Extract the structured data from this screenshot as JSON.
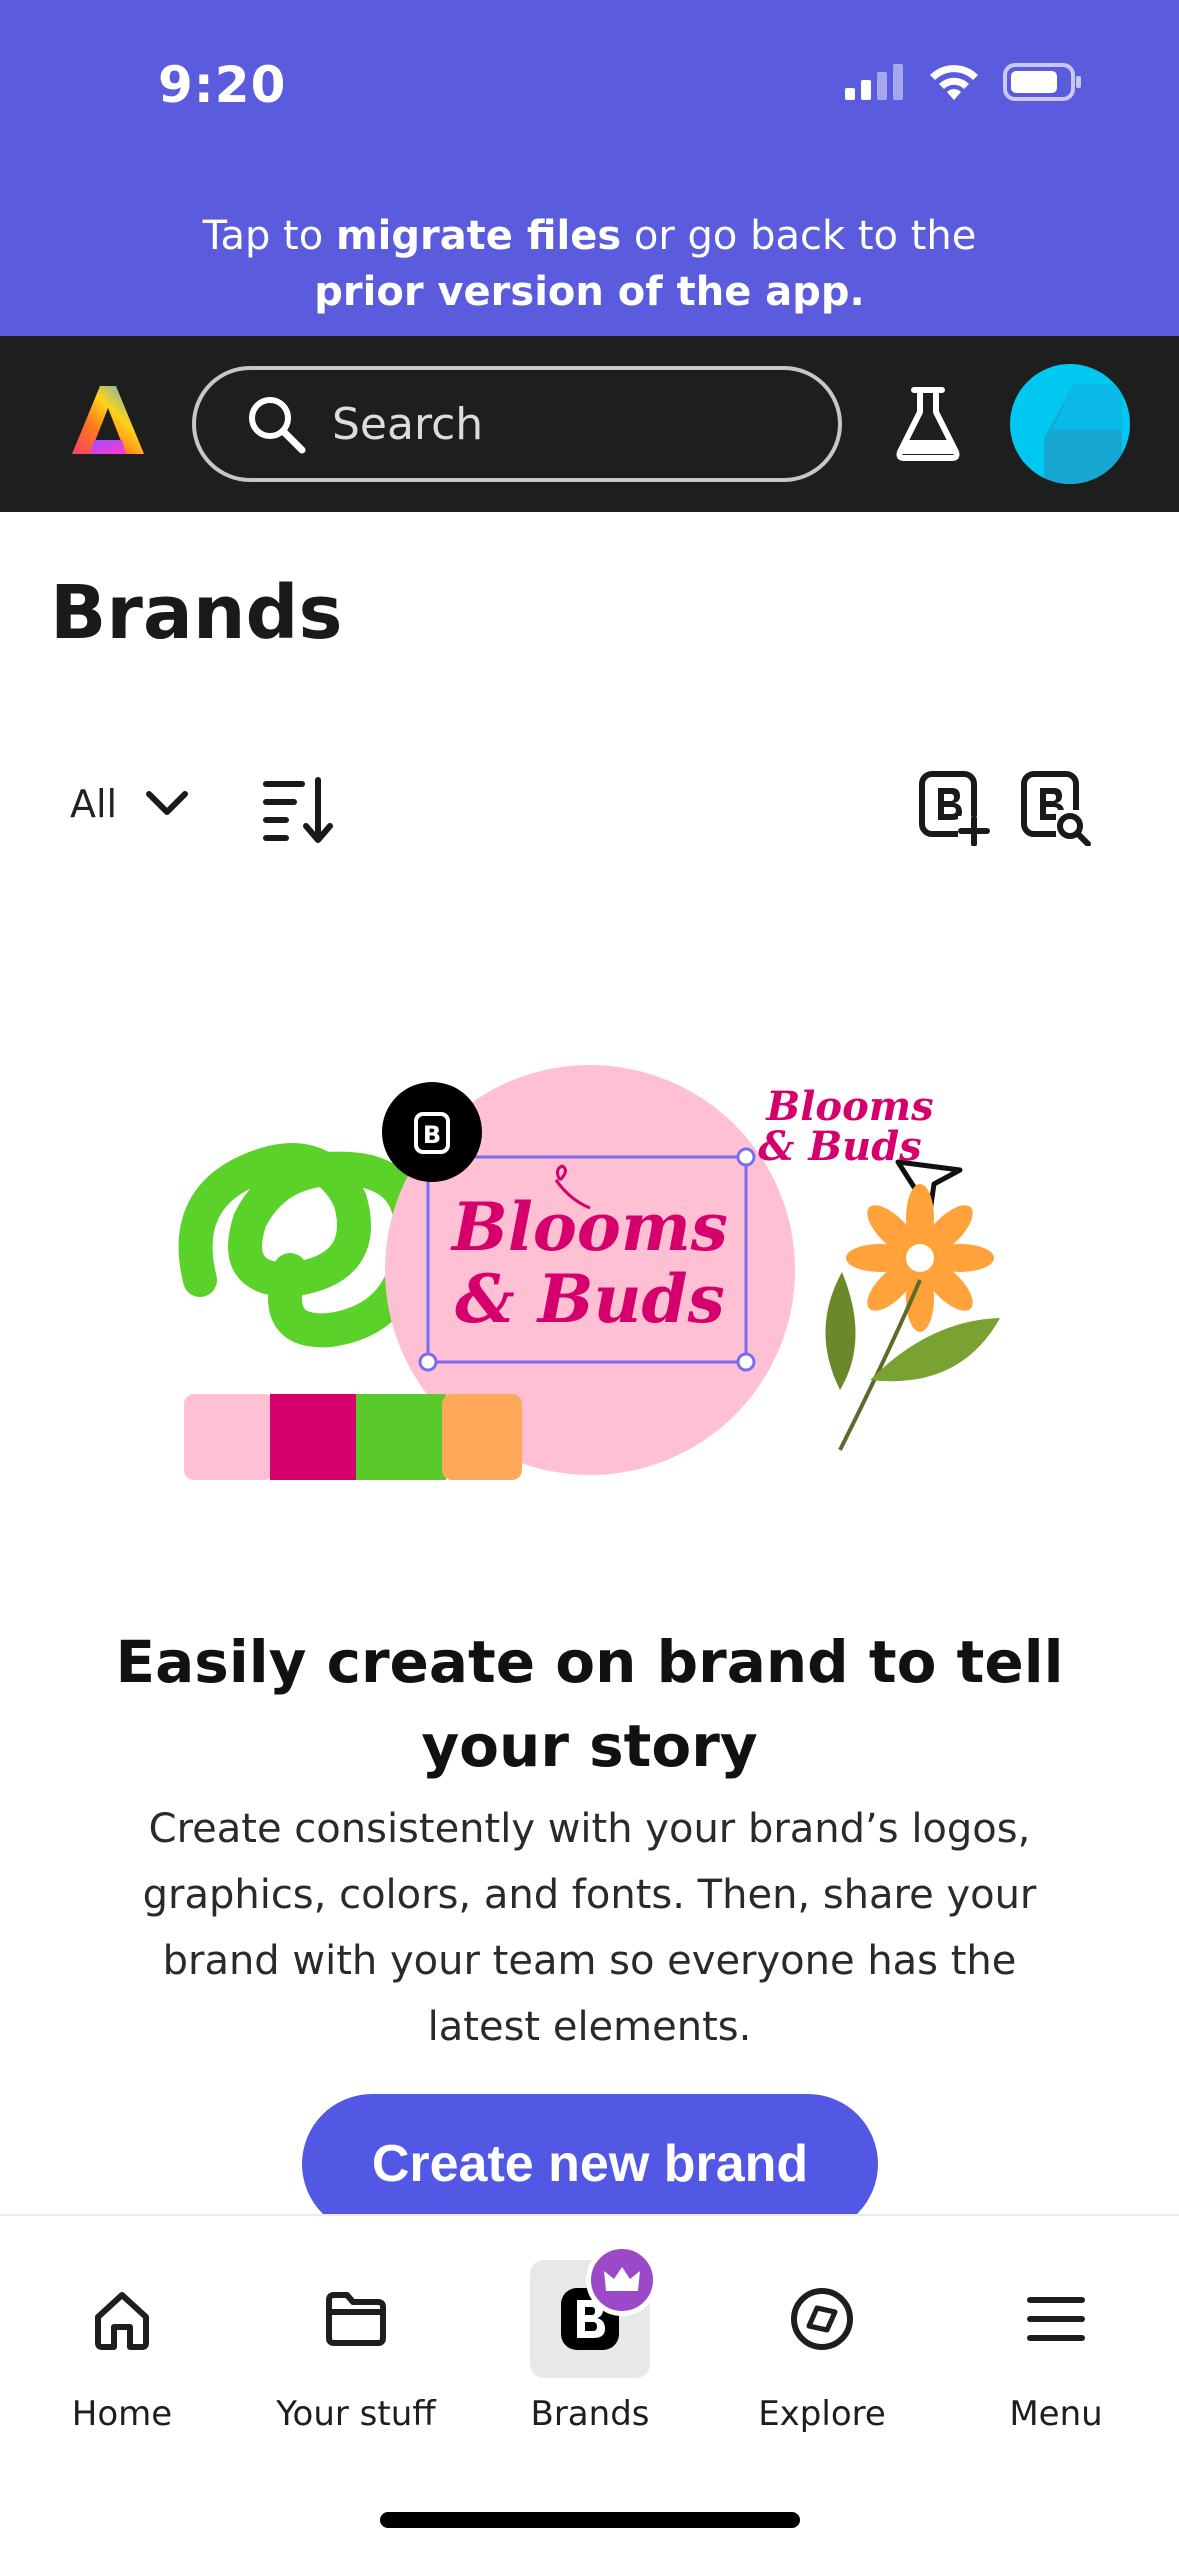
{
  "status_bar": {
    "time": "9:20"
  },
  "banner": {
    "text_1": "Tap to ",
    "text_bold_1": "migrate files",
    "text_2": " or go back to the",
    "text_bold_2": "prior version of the app."
  },
  "header": {
    "search_placeholder": "Search"
  },
  "page": {
    "title": "Brands",
    "filter_label": "All"
  },
  "illustration": {
    "logo_text_line1": "Blooms",
    "logo_text_line2": "& Buds",
    "badge_letter": "B",
    "palette": [
      "#ffc0d3",
      "#d6006c",
      "#5ac92a",
      "#ffa85a"
    ]
  },
  "empty_state": {
    "title": "Easily create on brand to tell your story",
    "body": "Create consistently with your brand’s logos, graphics, colors, and fonts. Then, share your brand with your team so everyone has the latest elements.",
    "cta": "Create new brand"
  },
  "bottom_nav": {
    "items": [
      {
        "label": "Home",
        "icon": "home-icon"
      },
      {
        "label": "Your stuff",
        "icon": "folder-icon"
      },
      {
        "label": "Brands",
        "icon": "brand-icon",
        "active": true
      },
      {
        "label": "Explore",
        "icon": "compass-icon"
      },
      {
        "label": "Menu",
        "icon": "menu-icon"
      }
    ]
  },
  "colors": {
    "banner": "#5b5bde",
    "appbar": "#1e1e1e",
    "accent": "#5258e4",
    "avatar": "#00c8f0",
    "premium": "#9b49c8"
  }
}
